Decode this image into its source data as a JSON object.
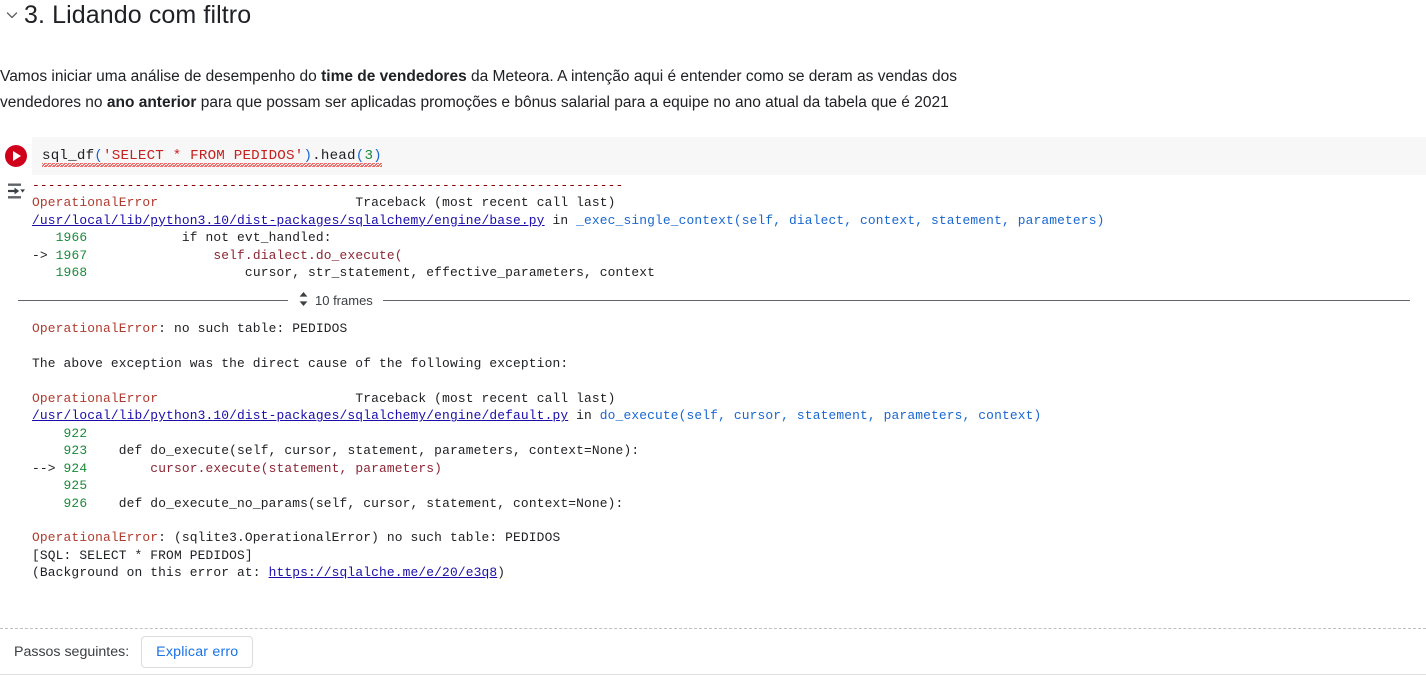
{
  "section": {
    "collapse_icon": "chevron-down-icon",
    "title": "3. Lidando com filtro"
  },
  "intro": {
    "line1_a": "Vamos iniciar uma análise de desempenho do ",
    "line1_b": "time de vendedores",
    "line1_c": " da Meteora. A intenção aqui é entender como se deram as vendas dos",
    "line2_a": "vendedores no ",
    "line2_b": "ano anterior",
    "line2_c": " para que possam ser aplicadas promoções e bônus salarial para a equipe no ano atual da tabela que é 2021"
  },
  "cell": {
    "run_icon": "play-icon",
    "output_toggle_icon": "output-scroll-toggle-icon",
    "code": {
      "fn": "sql_df",
      "open_paren": "(",
      "string": "'SELECT * FROM PEDIDOS'",
      "close_paren": ")",
      "method": ".head",
      "open_paren2": "(",
      "arg": "3",
      "close_paren2": ")"
    }
  },
  "traceback": {
    "dashes": "---------------------------------------------------------------------------",
    "block1": {
      "error_name": "OperationalError",
      "spacer": "                         ",
      "title": "Traceback (most recent call last)",
      "path": "/usr/local/lib/python3.10/dist-packages/sqlalchemy/engine/base.py",
      "in_word": " in ",
      "func": "_exec_single_context(self, dialect, context, statement, parameters)",
      "lines": [
        {
          "marker": "   ",
          "no": "1966",
          "code": "            if not evt_handled:",
          "highlight": false
        },
        {
          "marker": "-> ",
          "no": "1967",
          "code": "                self.dialect.do_execute(",
          "highlight": true
        },
        {
          "marker": "   ",
          "no": "1968",
          "code": "                    cursor, str_statement, effective_parameters, context",
          "highlight": false
        }
      ]
    },
    "frames": {
      "icon": "up-down-chevron-icon",
      "label": "10 frames"
    },
    "middle": {
      "error_line_name": "OperationalError",
      "error_line_msg": ": no such table: PEDIDOS",
      "cause_text": "The above exception was the direct cause of the following exception:"
    },
    "block2": {
      "error_name": "OperationalError",
      "spacer": "                         ",
      "title": "Traceback (most recent call last)",
      "path": "/usr/local/lib/python3.10/dist-packages/sqlalchemy/engine/default.py",
      "in_word": " in ",
      "func": "do_execute(self, cursor, statement, parameters, context)",
      "lines": [
        {
          "marker": "    ",
          "no": "922",
          "code": "",
          "highlight": false
        },
        {
          "marker": "    ",
          "no": "923",
          "code": "    def do_execute(self, cursor, statement, parameters, context=None):",
          "highlight": false
        },
        {
          "marker": "--> ",
          "no": "924",
          "code": "        cursor.execute(statement, parameters)",
          "highlight": true
        },
        {
          "marker": "    ",
          "no": "925",
          "code": "",
          "highlight": false
        },
        {
          "marker": "    ",
          "no": "926",
          "code": "    def do_execute_no_params(self, cursor, statement, context=None):",
          "highlight": false
        }
      ]
    },
    "final": {
      "error_name": "OperationalError",
      "error_msg": ": (sqlite3.OperationalError) no such table: PEDIDOS",
      "sql_line": "[SQL: SELECT * FROM PEDIDOS]",
      "background_prefix": "(Background on this error at: ",
      "background_link": "https://sqlalche.me/e/20/e3q8",
      "background_suffix": ")"
    }
  },
  "next_steps": {
    "label": "Passos seguintes:",
    "button": "Explicar erro"
  },
  "colors": {
    "run_red": "#d0021b",
    "link_blue": "#1a0dab",
    "button_blue": "#1a73e8",
    "error_red": "#b03a2e",
    "lineno_green": "#1a8a3a",
    "cell_bg": "#f7f7f7"
  }
}
